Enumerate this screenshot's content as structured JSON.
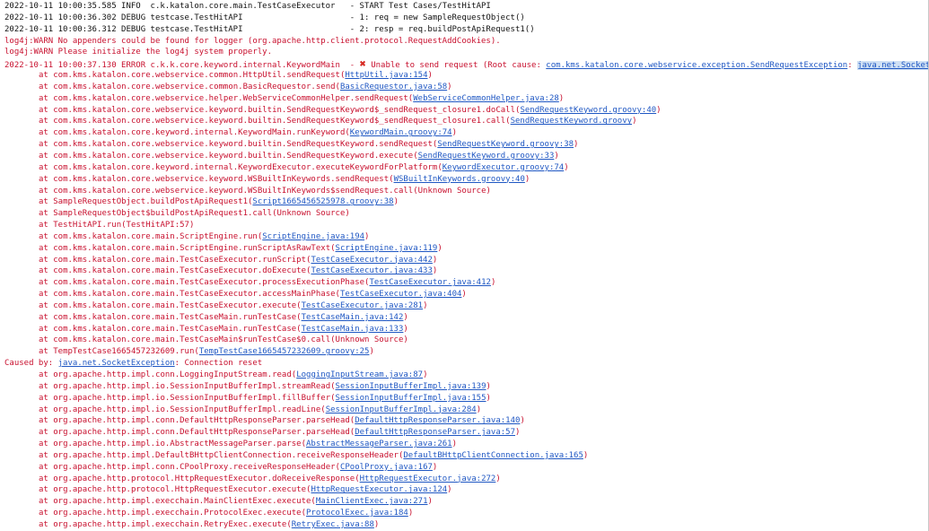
{
  "lines": [
    {
      "k": "info",
      "p": [
        {
          "t": "2022-10-11 10:00:35.585 INFO  c.k.katalon.core.main.TestCaseExecutor   - START Test Cases/TestHitAPI"
        }
      ]
    },
    {
      "k": "info",
      "p": [
        {
          "t": "2022-10-11 10:00:36.302 DEBUG testcase.TestHitAPI                      - 1: req = new SampleRequestObject()"
        }
      ]
    },
    {
      "k": "info",
      "p": [
        {
          "t": "2022-10-11 10:00:36.312 DEBUG testcase.TestHitAPI                      - 2: resp = req.buildPostApiRequest1()"
        }
      ]
    },
    {
      "k": "err",
      "p": [
        {
          "t": "log4j:WARN No appenders could be found for logger (org.apache.http.client.protocol.RequestAddCookies)."
        }
      ]
    },
    {
      "k": "err",
      "p": [
        {
          "t": "log4j:WARN Please initialize the log4j system properly."
        }
      ]
    },
    {
      "k": "err",
      "p": [
        {
          "t": "2022-10-11 10:00:37.130 ERROR c.k.k.core.keyword.internal.KeywordMain  - "
        },
        {
          "t": "✖",
          "c": "x"
        },
        {
          "t": " Unable to send request (Root cause: "
        },
        {
          "t": "com.kms.katalon.core.webservice.exception.SendRequestException",
          "c": "lnk"
        },
        {
          "t": ": "
        },
        {
          "t": "java.net.SocketException",
          "c": "lnk sel"
        },
        {
          "t": ": Connection reset",
          "c": "sel"
        },
        {
          "t": "",
          "c": "caret"
        }
      ]
    },
    {
      "k": "trace",
      "p": [
        {
          "t": "at com.kms.katalon.core.webservice.common.HttpUtil.sendRequest("
        },
        {
          "t": "HttpUtil.java:154",
          "c": "lnk"
        },
        {
          "t": ")"
        }
      ]
    },
    {
      "k": "trace",
      "p": [
        {
          "t": "at com.kms.katalon.core.webservice.common.BasicRequestor.send("
        },
        {
          "t": "BasicRequestor.java:58",
          "c": "lnk"
        },
        {
          "t": ")"
        }
      ]
    },
    {
      "k": "trace",
      "p": [
        {
          "t": "at com.kms.katalon.core.webservice.helper.WebServiceCommonHelper.sendRequest("
        },
        {
          "t": "WebServiceCommonHelper.java:28",
          "c": "lnk"
        },
        {
          "t": ")"
        }
      ]
    },
    {
      "k": "trace",
      "p": [
        {
          "t": "at com.kms.katalon.core.webservice.keyword.builtin.SendRequestKeyword$_sendRequest_closure1.doCall("
        },
        {
          "t": "SendRequestKeyword.groovy:40",
          "c": "lnk"
        },
        {
          "t": ")"
        }
      ]
    },
    {
      "k": "trace",
      "p": [
        {
          "t": "at com.kms.katalon.core.webservice.keyword.builtin.SendRequestKeyword$_sendRequest_closure1.call("
        },
        {
          "t": "SendRequestKeyword.groovy",
          "c": "lnk"
        },
        {
          "t": ")"
        }
      ]
    },
    {
      "k": "trace",
      "p": [
        {
          "t": "at com.kms.katalon.core.keyword.internal.KeywordMain.runKeyword("
        },
        {
          "t": "KeywordMain.groovy:74",
          "c": "lnk"
        },
        {
          "t": ")"
        }
      ]
    },
    {
      "k": "trace",
      "p": [
        {
          "t": "at com.kms.katalon.core.webservice.keyword.builtin.SendRequestKeyword.sendRequest("
        },
        {
          "t": "SendRequestKeyword.groovy:38",
          "c": "lnk"
        },
        {
          "t": ")"
        }
      ]
    },
    {
      "k": "trace",
      "p": [
        {
          "t": "at com.kms.katalon.core.webservice.keyword.builtin.SendRequestKeyword.execute("
        },
        {
          "t": "SendRequestKeyword.groovy:33",
          "c": "lnk"
        },
        {
          "t": ")"
        }
      ]
    },
    {
      "k": "trace",
      "p": [
        {
          "t": "at com.kms.katalon.core.keyword.internal.KeywordExecutor.executeKeywordForPlatform("
        },
        {
          "t": "KeywordExecutor.groovy:74",
          "c": "lnk"
        },
        {
          "t": ")"
        }
      ]
    },
    {
      "k": "trace",
      "p": [
        {
          "t": "at com.kms.katalon.core.webservice.keyword.WSBuiltInKeywords.sendRequest("
        },
        {
          "t": "WSBuiltInKeywords.groovy:40",
          "c": "lnk"
        },
        {
          "t": ")"
        }
      ]
    },
    {
      "k": "trace",
      "p": [
        {
          "t": "at com.kms.katalon.core.webservice.keyword.WSBuiltInKeywords$sendRequest.call(Unknown Source)"
        }
      ]
    },
    {
      "k": "trace",
      "p": [
        {
          "t": "at SampleRequestObject.buildPostApiRequest1("
        },
        {
          "t": "Script1665456525978.groovy:38",
          "c": "lnk"
        },
        {
          "t": ")"
        }
      ]
    },
    {
      "k": "trace",
      "p": [
        {
          "t": "at SampleRequestObject$buildPostApiRequest1.call(Unknown Source)"
        }
      ]
    },
    {
      "k": "trace",
      "p": [
        {
          "t": "at TestHitAPI.run(TestHitAPI:57)"
        }
      ]
    },
    {
      "k": "trace",
      "p": [
        {
          "t": "at com.kms.katalon.core.main.ScriptEngine.run("
        },
        {
          "t": "ScriptEngine.java:194",
          "c": "lnk"
        },
        {
          "t": ")"
        }
      ]
    },
    {
      "k": "trace",
      "p": [
        {
          "t": "at com.kms.katalon.core.main.ScriptEngine.runScriptAsRawText("
        },
        {
          "t": "ScriptEngine.java:119",
          "c": "lnk"
        },
        {
          "t": ")"
        }
      ]
    },
    {
      "k": "trace",
      "p": [
        {
          "t": "at com.kms.katalon.core.main.TestCaseExecutor.runScript("
        },
        {
          "t": "TestCaseExecutor.java:442",
          "c": "lnk"
        },
        {
          "t": ")"
        }
      ]
    },
    {
      "k": "trace",
      "p": [
        {
          "t": "at com.kms.katalon.core.main.TestCaseExecutor.doExecute("
        },
        {
          "t": "TestCaseExecutor.java:433",
          "c": "lnk"
        },
        {
          "t": ")"
        }
      ]
    },
    {
      "k": "trace",
      "p": [
        {
          "t": "at com.kms.katalon.core.main.TestCaseExecutor.processExecutionPhase("
        },
        {
          "t": "TestCaseExecutor.java:412",
          "c": "lnk"
        },
        {
          "t": ")"
        }
      ]
    },
    {
      "k": "trace",
      "p": [
        {
          "t": "at com.kms.katalon.core.main.TestCaseExecutor.accessMainPhase("
        },
        {
          "t": "TestCaseExecutor.java:404",
          "c": "lnk"
        },
        {
          "t": ")"
        }
      ]
    },
    {
      "k": "trace",
      "p": [
        {
          "t": "at com.kms.katalon.core.main.TestCaseExecutor.execute("
        },
        {
          "t": "TestCaseExecutor.java:281",
          "c": "lnk"
        },
        {
          "t": ")"
        }
      ]
    },
    {
      "k": "trace",
      "p": [
        {
          "t": "at com.kms.katalon.core.main.TestCaseMain.runTestCase("
        },
        {
          "t": "TestCaseMain.java:142",
          "c": "lnk"
        },
        {
          "t": ")"
        }
      ]
    },
    {
      "k": "trace",
      "p": [
        {
          "t": "at com.kms.katalon.core.main.TestCaseMain.runTestCase("
        },
        {
          "t": "TestCaseMain.java:133",
          "c": "lnk"
        },
        {
          "t": ")"
        }
      ]
    },
    {
      "k": "trace",
      "p": [
        {
          "t": "at com.kms.katalon.core.main.TestCaseMain$runTestCase$0.call(Unknown Source)"
        }
      ]
    },
    {
      "k": "trace",
      "p": [
        {
          "t": "at TempTestCase1665457232609.run("
        },
        {
          "t": "TempTestCase1665457232609.groovy:25",
          "c": "lnk"
        },
        {
          "t": ")"
        }
      ]
    },
    {
      "k": "err",
      "p": [
        {
          "t": "Caused by: "
        },
        {
          "t": "java.net.SocketException",
          "c": "lnk"
        },
        {
          "t": ": Connection reset"
        }
      ]
    },
    {
      "k": "trace",
      "p": [
        {
          "t": "at org.apache.http.impl.conn.LoggingInputStream.read("
        },
        {
          "t": "LoggingInputStream.java:87",
          "c": "lnk"
        },
        {
          "t": ")"
        }
      ]
    },
    {
      "k": "trace",
      "p": [
        {
          "t": "at org.apache.http.impl.io.SessionInputBufferImpl.streamRead("
        },
        {
          "t": "SessionInputBufferImpl.java:139",
          "c": "lnk"
        },
        {
          "t": ")"
        }
      ]
    },
    {
      "k": "trace",
      "p": [
        {
          "t": "at org.apache.http.impl.io.SessionInputBufferImpl.fillBuffer("
        },
        {
          "t": "SessionInputBufferImpl.java:155",
          "c": "lnk"
        },
        {
          "t": ")"
        }
      ]
    },
    {
      "k": "trace",
      "p": [
        {
          "t": "at org.apache.http.impl.io.SessionInputBufferImpl.readLine("
        },
        {
          "t": "SessionInputBufferImpl.java:284",
          "c": "lnk"
        },
        {
          "t": ")"
        }
      ]
    },
    {
      "k": "trace",
      "p": [
        {
          "t": "at org.apache.http.impl.conn.DefaultHttpResponseParser.parseHead("
        },
        {
          "t": "DefaultHttpResponseParser.java:140",
          "c": "lnk"
        },
        {
          "t": ")"
        }
      ]
    },
    {
      "k": "trace",
      "p": [
        {
          "t": "at org.apache.http.impl.conn.DefaultHttpResponseParser.parseHead("
        },
        {
          "t": "DefaultHttpResponseParser.java:57",
          "c": "lnk"
        },
        {
          "t": ")"
        }
      ]
    },
    {
      "k": "trace",
      "p": [
        {
          "t": "at org.apache.http.impl.io.AbstractMessageParser.parse("
        },
        {
          "t": "AbstractMessageParser.java:261",
          "c": "lnk"
        },
        {
          "t": ")"
        }
      ]
    },
    {
      "k": "trace",
      "p": [
        {
          "t": "at org.apache.http.impl.DefaultBHttpClientConnection.receiveResponseHeader("
        },
        {
          "t": "DefaultBHttpClientConnection.java:165",
          "c": "lnk"
        },
        {
          "t": ")"
        }
      ]
    },
    {
      "k": "trace",
      "p": [
        {
          "t": "at org.apache.http.impl.conn.CPoolProxy.receiveResponseHeader("
        },
        {
          "t": "CPoolProxy.java:167",
          "c": "lnk"
        },
        {
          "t": ")"
        }
      ]
    },
    {
      "k": "trace",
      "p": [
        {
          "t": "at org.apache.http.protocol.HttpRequestExecutor.doReceiveResponse("
        },
        {
          "t": "HttpRequestExecutor.java:272",
          "c": "lnk"
        },
        {
          "t": ")"
        }
      ]
    },
    {
      "k": "trace",
      "p": [
        {
          "t": "at org.apache.http.protocol.HttpRequestExecutor.execute("
        },
        {
          "t": "HttpRequestExecutor.java:124",
          "c": "lnk"
        },
        {
          "t": ")"
        }
      ]
    },
    {
      "k": "trace",
      "p": [
        {
          "t": "at org.apache.http.impl.execchain.MainClientExec.execute("
        },
        {
          "t": "MainClientExec.java:271",
          "c": "lnk"
        },
        {
          "t": ")"
        }
      ]
    },
    {
      "k": "trace",
      "p": [
        {
          "t": "at org.apache.http.impl.execchain.ProtocolExec.execute("
        },
        {
          "t": "ProtocolExec.java:184",
          "c": "lnk"
        },
        {
          "t": ")"
        }
      ]
    },
    {
      "k": "trace",
      "p": [
        {
          "t": "at org.apache.http.impl.execchain.RetryExec.execute("
        },
        {
          "t": "RetryExec.java:88",
          "c": "lnk"
        },
        {
          "t": ")"
        }
      ]
    }
  ],
  "colors": {
    "info": "#111111",
    "error": "#c8102e",
    "link": "#1f57c3",
    "selection": "#cfe0f4",
    "error_icon": "#d6271f"
  },
  "icons": {
    "error_marker": "close-icon"
  }
}
